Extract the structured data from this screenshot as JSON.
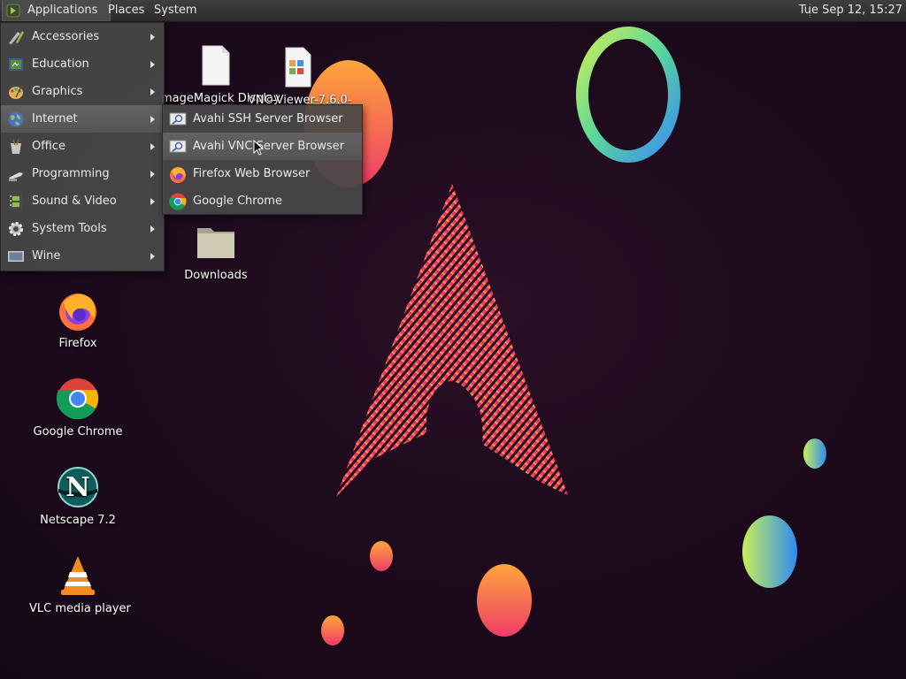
{
  "panel": {
    "applications_label": "Applications",
    "places_label": "Places",
    "system_label": "System",
    "clock": "Tue Sep 12, 15:27"
  },
  "applications_menu": {
    "items": [
      {
        "label": "Accessories",
        "icon": "accessories-icon"
      },
      {
        "label": "Education",
        "icon": "education-icon"
      },
      {
        "label": "Graphics",
        "icon": "graphics-icon"
      },
      {
        "label": "Internet",
        "icon": "internet-icon",
        "highlighted": true
      },
      {
        "label": "Office",
        "icon": "office-icon"
      },
      {
        "label": "Programming",
        "icon": "programming-icon"
      },
      {
        "label": "Sound & Video",
        "icon": "sound-video-icon"
      },
      {
        "label": "System Tools",
        "icon": "system-tools-icon"
      },
      {
        "label": "Wine",
        "icon": "wine-icon"
      }
    ]
  },
  "internet_submenu": {
    "items": [
      {
        "label": "Avahi SSH Server Browser",
        "icon": "network-browser-icon"
      },
      {
        "label": "Avahi VNC Server Browser",
        "icon": "network-browser-icon",
        "highlighted": true
      },
      {
        "label": "Firefox Web Browser",
        "icon": "firefox-icon"
      },
      {
        "label": "Google Chrome",
        "icon": "chrome-icon"
      }
    ]
  },
  "desktop": {
    "icons": [
      {
        "label": "mageMagick Display",
        "icon": "file-icon"
      },
      {
        "label": "VNC-Viewer-7.6.0-",
        "icon": "vnc-file-icon"
      },
      {
        "label": "Downloads",
        "icon": "folder-icon"
      },
      {
        "label": "Firefox",
        "icon": "firefox-icon"
      },
      {
        "label": "Google Chrome",
        "icon": "chrome-icon"
      },
      {
        "label": "Netscape 7.2",
        "icon": "netscape-icon"
      },
      {
        "label": "VLC media player",
        "icon": "vlc-icon"
      }
    ]
  },
  "colors": {
    "background": "#1e0b1d",
    "accent_pink": "#e0246c",
    "accent_orange": "#f7a23a"
  }
}
